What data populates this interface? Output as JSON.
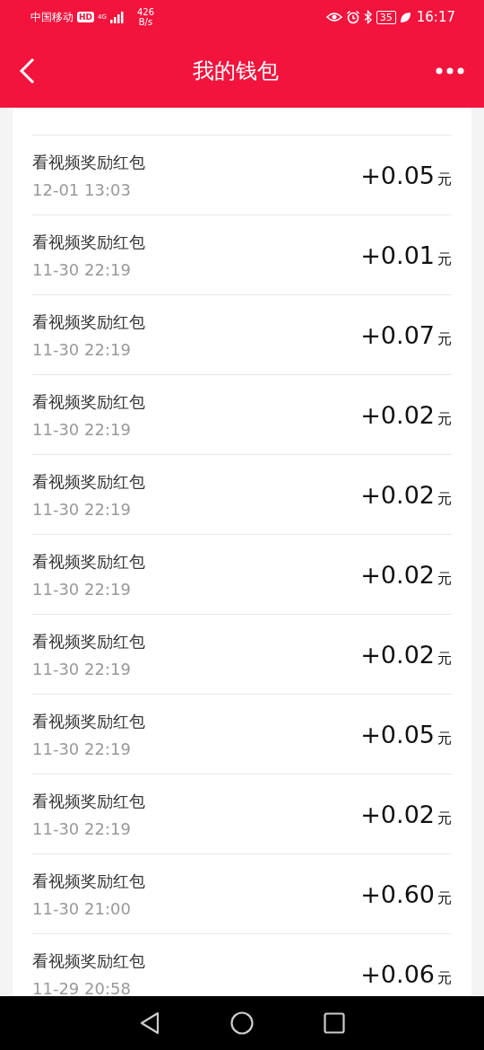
{
  "status_bar": {
    "carrier": "中国移动",
    "hd_badge": "HD",
    "network_type": "4G",
    "speed_value": "426",
    "speed_unit": "B/s",
    "battery": "35",
    "time": "16:17"
  },
  "header": {
    "title": "我的钱包"
  },
  "records": [
    {
      "title": "看视频奖励红包",
      "date": "12-01 13:03",
      "amount": "+0.05",
      "unit": "元"
    },
    {
      "title": "看视频奖励红包",
      "date": "11-30 22:19",
      "amount": "+0.01",
      "unit": "元"
    },
    {
      "title": "看视频奖励红包",
      "date": "11-30 22:19",
      "amount": "+0.07",
      "unit": "元"
    },
    {
      "title": "看视频奖励红包",
      "date": "11-30 22:19",
      "amount": "+0.02",
      "unit": "元"
    },
    {
      "title": "看视频奖励红包",
      "date": "11-30 22:19",
      "amount": "+0.02",
      "unit": "元"
    },
    {
      "title": "看视频奖励红包",
      "date": "11-30 22:19",
      "amount": "+0.02",
      "unit": "元"
    },
    {
      "title": "看视频奖励红包",
      "date": "11-30 22:19",
      "amount": "+0.02",
      "unit": "元"
    },
    {
      "title": "看视频奖励红包",
      "date": "11-30 22:19",
      "amount": "+0.05",
      "unit": "元"
    },
    {
      "title": "看视频奖励红包",
      "date": "11-30 22:19",
      "amount": "+0.02",
      "unit": "元"
    },
    {
      "title": "看视频奖励红包",
      "date": "11-30 21:00",
      "amount": "+0.60",
      "unit": "元"
    },
    {
      "title": "看视频奖励红包",
      "date": "11-29 20:58",
      "amount": "+0.06",
      "unit": "元"
    }
  ]
}
